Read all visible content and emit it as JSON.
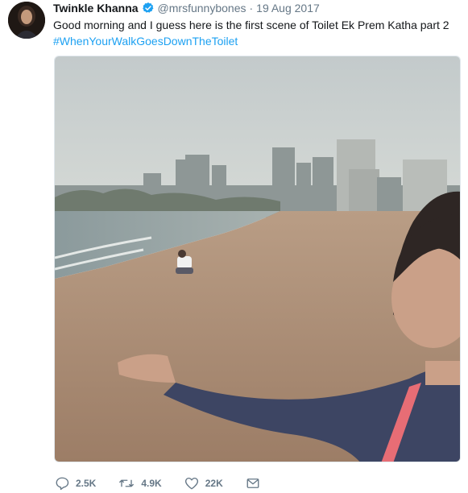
{
  "tweet": {
    "author_name": "Twinkle Khanna",
    "handle": "@mrsfunnybones",
    "separator": "·",
    "date": "19 Aug 2017",
    "text": "Good morning and I guess here is the first scene of Toilet Ek Prem Katha part 2",
    "hashtag": "#WhenYourWalkGoesDownTheToilet"
  },
  "actions": {
    "reply_count": "2.5K",
    "retweet_count": "4.9K",
    "like_count": "22K"
  },
  "colors": {
    "link": "#1da1f2",
    "muted": "#657786",
    "verified": "#1da1f2"
  },
  "icons": {
    "verified": "verified-badge-icon",
    "reply": "reply-icon",
    "retweet": "retweet-icon",
    "like": "heart-icon",
    "message": "envelope-icon"
  }
}
